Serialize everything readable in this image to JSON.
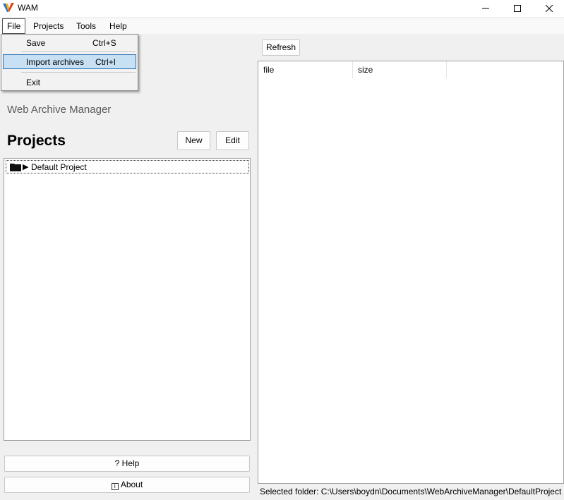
{
  "window": {
    "title": "WAM"
  },
  "menubar": {
    "file": "File",
    "projects": "Projects",
    "tools": "Tools",
    "help": "Help"
  },
  "file_menu": {
    "save": {
      "label": "Save",
      "shortcut": "Ctrl+S"
    },
    "import": {
      "label": "Import archives",
      "shortcut": "Ctrl+I"
    },
    "exit": {
      "label": "Exit"
    }
  },
  "left": {
    "app_name": "Web Archive Manager",
    "projects_heading": "Projects",
    "new_label": "New",
    "edit_label": "Edit",
    "tree": [
      {
        "label": "Default Project",
        "icon": "folder-icon"
      }
    ],
    "help_label": "? Help",
    "about_label": "About"
  },
  "right": {
    "refresh_label": "Refresh",
    "columns": [
      "file",
      "size"
    ],
    "status": "Selected folder: C:\\Users\\boydn\\Documents\\WebArchiveManager\\DefaultProject"
  },
  "colors": {
    "accent_red": "#d9301c",
    "selection": "#c7e0f4"
  }
}
